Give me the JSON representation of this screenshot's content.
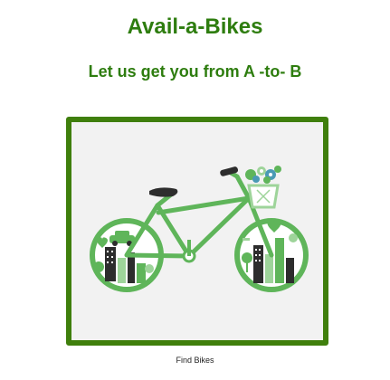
{
  "header": {
    "title": "Avail-a-Bikes",
    "subtitle": "Let us get you from A -to- B"
  },
  "hero": {
    "image_name": "bicycle-city-illustration-icon",
    "colors": {
      "frame_border": "#3f7f0c",
      "bike_green": "#5fb55a",
      "dark": "#2d2d2d",
      "light_green": "#9ed49a"
    }
  },
  "actions": {
    "find_bikes_label": "Find Bikes"
  },
  "theme": {
    "heading_color": "#2e7d0f"
  }
}
